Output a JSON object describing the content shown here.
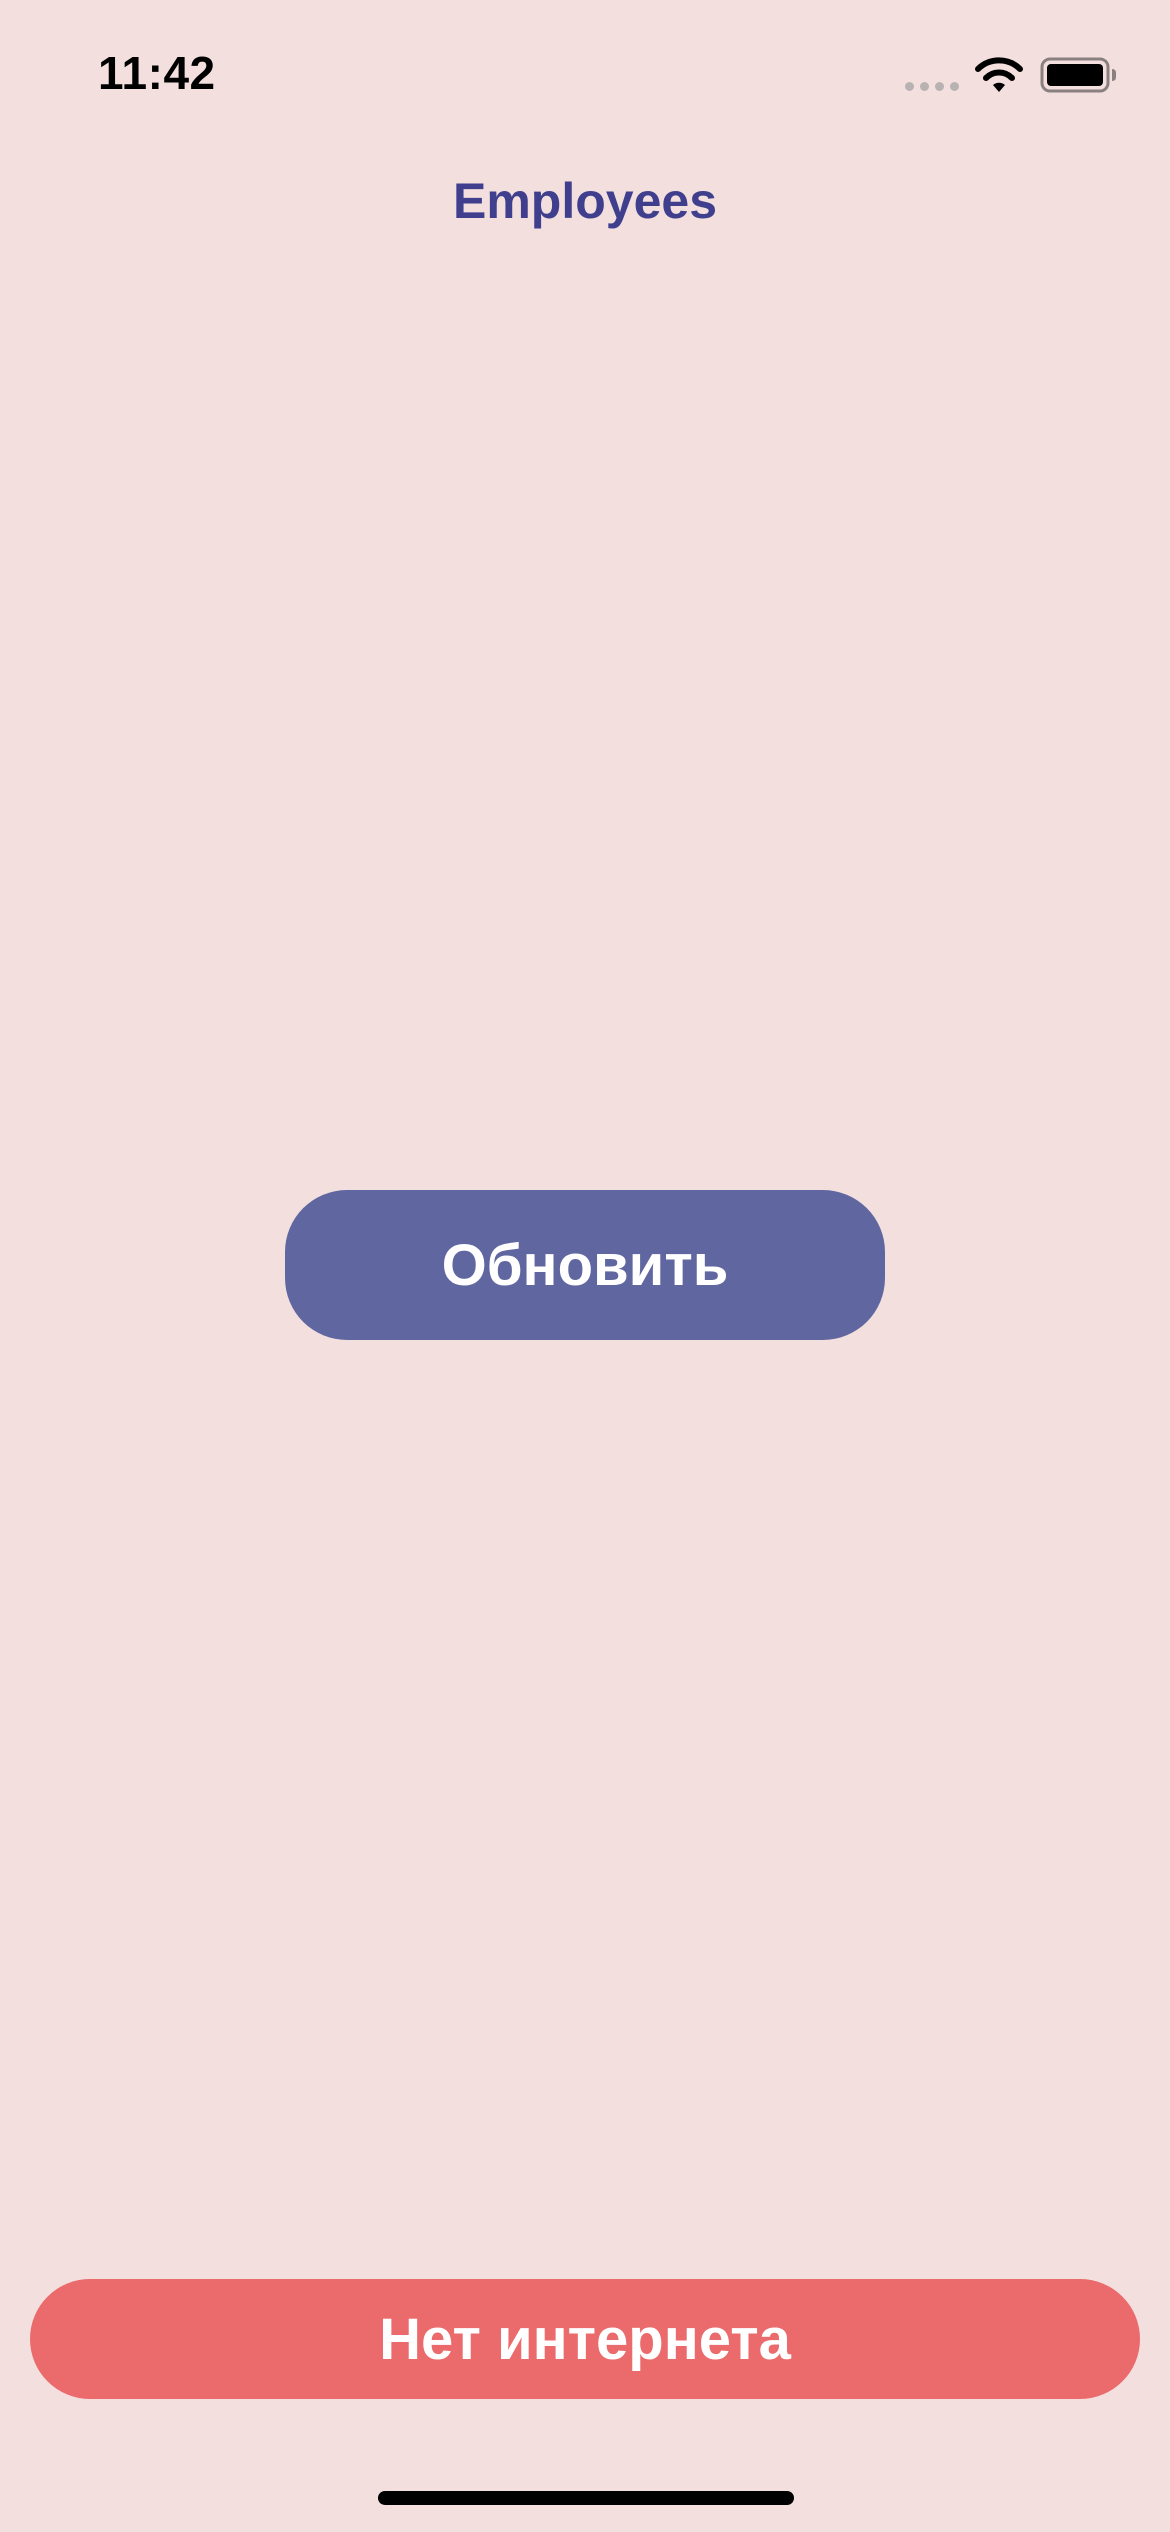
{
  "status_bar": {
    "time": "11:42"
  },
  "icons": {
    "signal": "cellular-signal-icon",
    "wifi": "wifi-icon",
    "battery": "battery-icon"
  },
  "nav": {
    "title": "Employees"
  },
  "main": {
    "refresh_label": "Обновить"
  },
  "banner": {
    "text": "Нет интернета"
  },
  "colors": {
    "background": "#F2DFDE",
    "title": "#3F3F8E",
    "refresh_button": "#6067A0",
    "banner": "#EB6A6C"
  }
}
